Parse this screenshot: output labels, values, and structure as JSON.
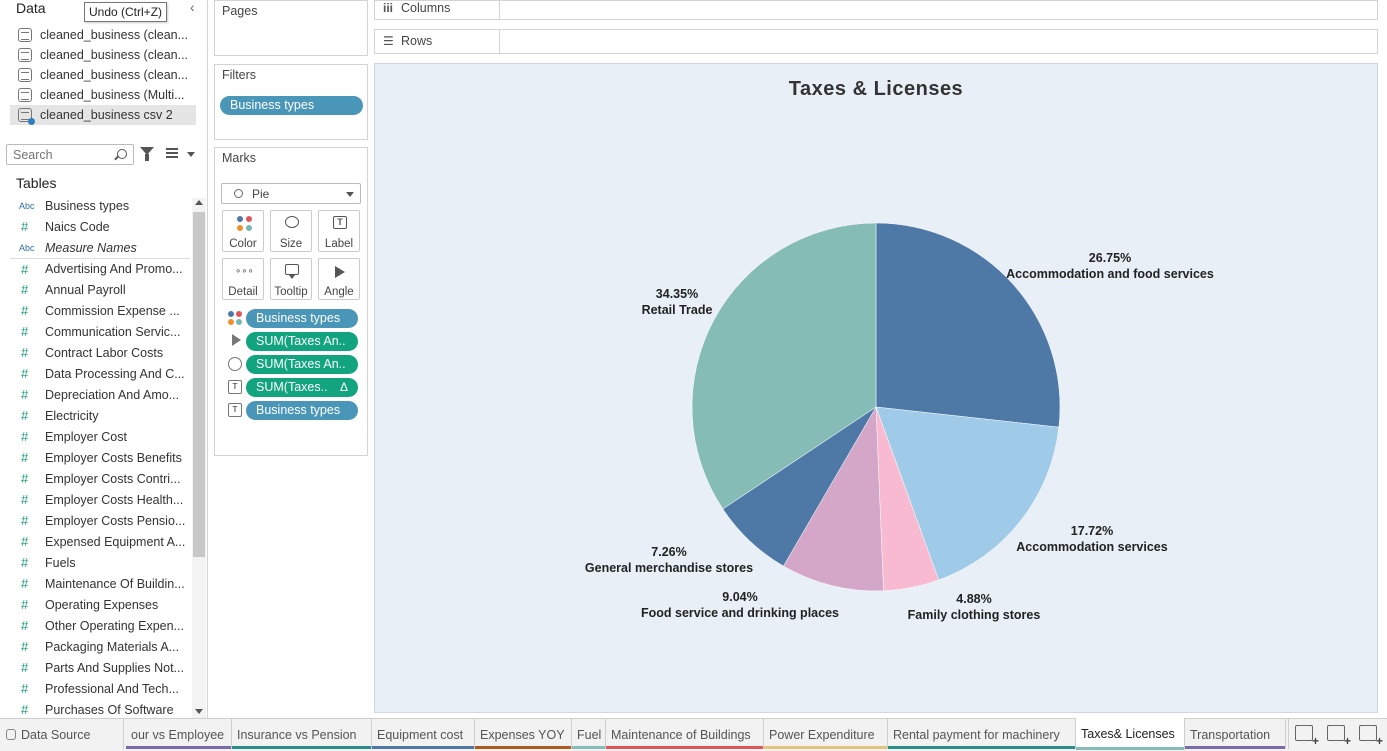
{
  "data_pane": {
    "title": "Data",
    "undo_tooltip": "Undo (Ctrl+Z)",
    "datasources": [
      {
        "label": "cleaned_business (clean...",
        "selected": false
      },
      {
        "label": "cleaned_business (clean...",
        "selected": false
      },
      {
        "label": "cleaned_business (clean...",
        "selected": false
      },
      {
        "label": "cleaned_business (Multi...",
        "selected": false
      },
      {
        "label": "cleaned_business csv 2",
        "selected": true
      }
    ],
    "search_placeholder": "Search",
    "tables_title": "Tables",
    "fields": [
      {
        "type": "Abc",
        "label": "Business types"
      },
      {
        "type": "#",
        "label": "Naics Code"
      },
      {
        "type": "Abc",
        "label": "Measure Names",
        "italic": true
      },
      {
        "type": "#",
        "label": "Advertising And Promo...",
        "sep": true
      },
      {
        "type": "#",
        "label": "Annual Payroll"
      },
      {
        "type": "#",
        "label": "Commission Expense ..."
      },
      {
        "type": "#",
        "label": "Communication Servic..."
      },
      {
        "type": "#",
        "label": "Contract Labor Costs"
      },
      {
        "type": "#",
        "label": "Data Processing And C..."
      },
      {
        "type": "#",
        "label": "Depreciation And Amo..."
      },
      {
        "type": "#",
        "label": "Electricity"
      },
      {
        "type": "#",
        "label": "Employer Cost"
      },
      {
        "type": "#",
        "label": "Employer Costs Benefits"
      },
      {
        "type": "#",
        "label": "Employer Costs Contri..."
      },
      {
        "type": "#",
        "label": "Employer Costs Health..."
      },
      {
        "type": "#",
        "label": "Employer Costs Pensio..."
      },
      {
        "type": "#",
        "label": "Expensed Equipment A..."
      },
      {
        "type": "#",
        "label": "Fuels"
      },
      {
        "type": "#",
        "label": "Maintenance Of Buildin..."
      },
      {
        "type": "#",
        "label": "Operating Expenses"
      },
      {
        "type": "#",
        "label": "Other Operating Expen..."
      },
      {
        "type": "#",
        "label": "Packaging Materials A..."
      },
      {
        "type": "#",
        "label": "Parts And Supplies Not..."
      },
      {
        "type": "#",
        "label": "Professional And Tech..."
      },
      {
        "type": "#",
        "label": "Purchases Of Software"
      }
    ]
  },
  "pages": {
    "title": "Pages"
  },
  "filters": {
    "title": "Filters",
    "pill": "Business types"
  },
  "marks": {
    "title": "Marks",
    "mark_type": "Pie",
    "buttons": {
      "color": "Color",
      "size": "Size",
      "label": "Label",
      "detail": "Detail",
      "tooltip": "Tooltip",
      "angle": "Angle"
    },
    "pills": [
      {
        "label": "Business types",
        "kind": "color",
        "style": "blue"
      },
      {
        "label": "SUM(Taxes An..",
        "kind": "angle",
        "style": "green"
      },
      {
        "label": "SUM(Taxes An..",
        "kind": "size",
        "style": "green"
      },
      {
        "label": "SUM(Taxes..",
        "kind": "label",
        "style": "green",
        "delta": "Δ"
      },
      {
        "label": "Business types",
        "kind": "label",
        "style": "blue"
      }
    ],
    "color_dots": [
      "#4e79a7",
      "#e15759",
      "#f28e2b",
      "#76b7b2"
    ]
  },
  "shelves": {
    "columns": "Columns",
    "rows": "Rows"
  },
  "chart_data": {
    "type": "pie",
    "title": "Taxes  &  Licenses",
    "slices": [
      {
        "name": "Accommodation and food services",
        "percent": 26.75,
        "label": "26.75%",
        "color": "#4e79a7"
      },
      {
        "name": "Accommodation services",
        "percent": 17.72,
        "label": "17.72%",
        "color": "#a0cbe8"
      },
      {
        "name": "Family clothing stores",
        "percent": 4.88,
        "label": "4.88%",
        "color": "#f8bad0"
      },
      {
        "name": "Food service and drinking places",
        "percent": 9.04,
        "label": "9.04%",
        "color": "#d4a6c8"
      },
      {
        "name": "General merchandise stores",
        "percent": 7.26,
        "label": "7.26%",
        "color": "#4e79a7"
      },
      {
        "name": "Retail Trade",
        "percent": 34.35,
        "label": "34.35%",
        "color": "#86bcb6"
      }
    ]
  },
  "tabs": {
    "data_source": "Data Source",
    "sheets": [
      {
        "label": "our vs Employee",
        "accent": "#7b6ba8",
        "active": false
      },
      {
        "label": "Insurance  vs  Pension",
        "accent": "#2a8f8a",
        "active": false
      },
      {
        "label": "Equipment cost",
        "accent": "#4e79a7",
        "active": false
      },
      {
        "label": "Expenses  YOY",
        "accent": "#b05a1e",
        "active": false
      },
      {
        "label": "Fuel",
        "accent": "#86bcb6",
        "active": false
      },
      {
        "label": "Maintenance of Buildings",
        "accent": "#e15759",
        "active": false
      },
      {
        "label": "Power  Expenditure",
        "accent": "#e2c37a",
        "active": false
      },
      {
        "label": "Rental payment for machinery",
        "accent": "#2a8f8a",
        "active": false
      },
      {
        "label": "Taxes& Licenses",
        "accent": "#86bcb6",
        "active": true
      },
      {
        "label": "Transportation",
        "accent": "#7b6ba8",
        "active": false
      }
    ]
  }
}
